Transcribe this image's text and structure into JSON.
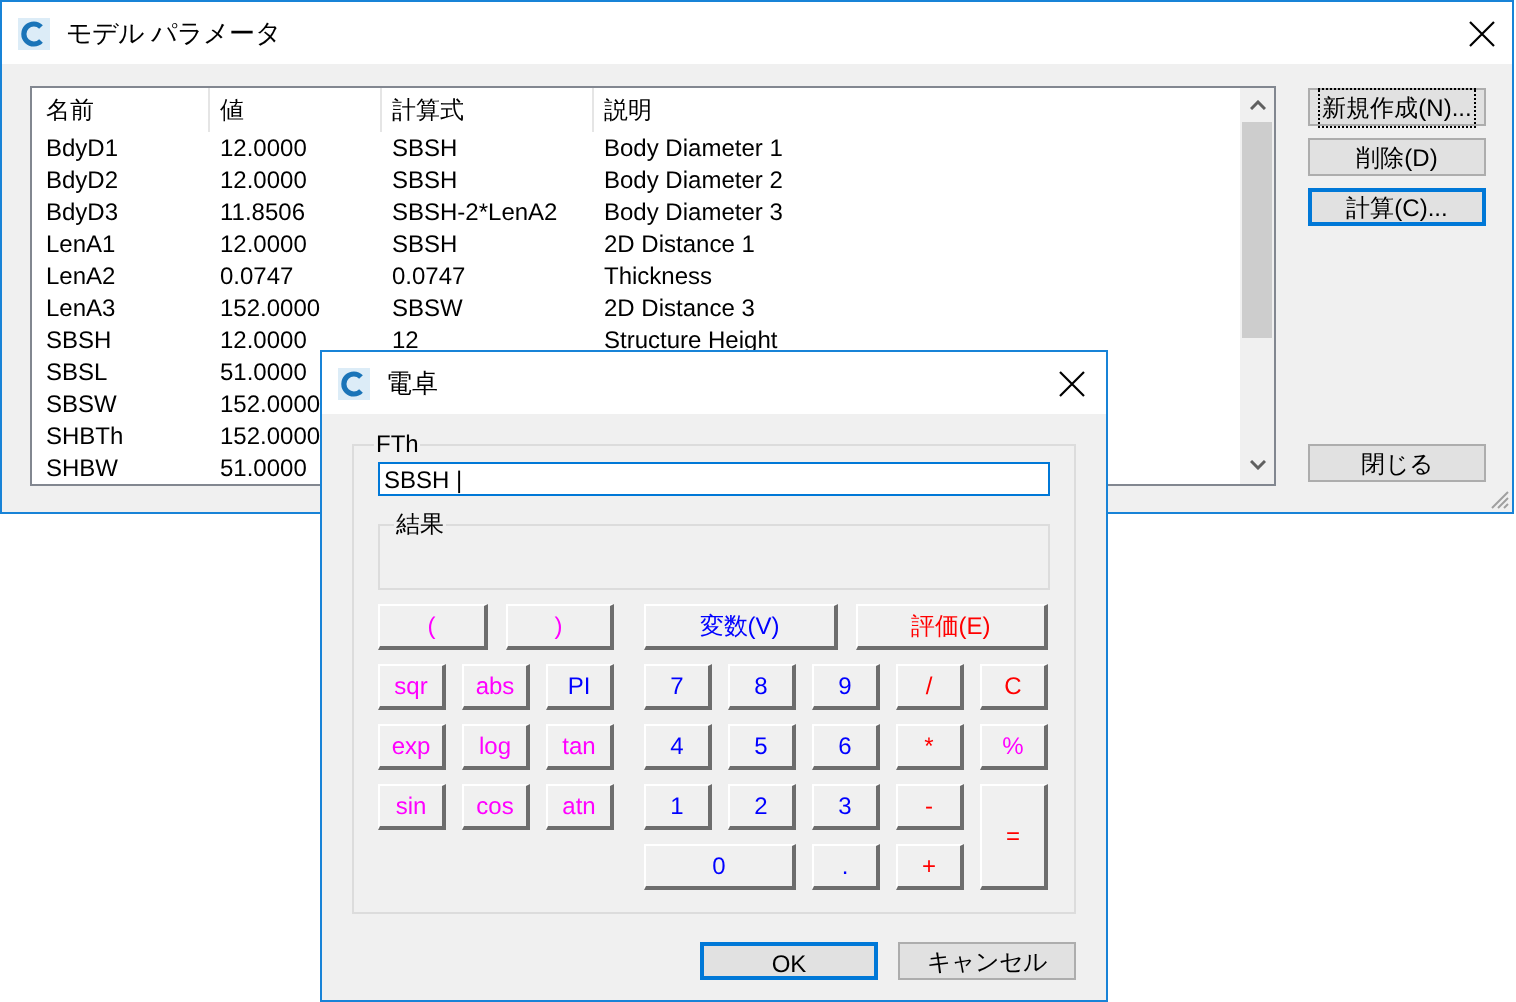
{
  "main_window": {
    "title": "モデル パラメータ",
    "table": {
      "columns": [
        "名前",
        "値",
        "計算式",
        "説明"
      ],
      "rows": [
        {
          "cells": [
            "BdyD1",
            "12.0000",
            "SBSH",
            "Body Diameter 1"
          ]
        },
        {
          "cells": [
            "BdyD2",
            "12.0000",
            "SBSH",
            "Body Diameter 2"
          ]
        },
        {
          "cells": [
            "BdyD3",
            "11.8506",
            "SBSH-2*LenA2",
            "Body Diameter 3"
          ]
        },
        {
          "cells": [
            "LenA1",
            "12.0000",
            "SBSH",
            "2D Distance 1"
          ]
        },
        {
          "cells": [
            "LenA2",
            "0.0747",
            "0.0747",
            "Thickness"
          ]
        },
        {
          "cells": [
            "LenA3",
            "152.0000",
            "SBSW",
            "2D Distance 3"
          ]
        },
        {
          "cells": [
            "SBSH",
            "12.0000",
            "12",
            "Structure Height"
          ]
        },
        {
          "cells": [
            "SBSL",
            "51.0000"
          ]
        },
        {
          "cells": [
            "SBSW",
            "152.0000"
          ]
        },
        {
          "cells": [
            "SHBTh",
            "152.0000"
          ]
        },
        {
          "cells": [
            "SHBW",
            "51.0000"
          ]
        }
      ]
    },
    "buttons": [
      {
        "label": "新規作成(N)...",
        "focused": true,
        "default": false
      },
      {
        "label": "削除(D)",
        "focused": false,
        "default": false
      },
      {
        "label": "計算(C)...",
        "focused": false,
        "default": true
      }
    ],
    "close_button": "閉じる"
  },
  "calculator": {
    "title": "電卓",
    "expression_label": "FTh",
    "expression": "SBSH |",
    "result_label": "結果",
    "top_keys": [
      {
        "label": "(",
        "color": "#ff00ff"
      },
      {
        "label": ")",
        "color": "#ff00ff"
      },
      {
        "label": "変数(V)",
        "color": "#0000ff"
      },
      {
        "label": "評価(E)",
        "color": "#ff0000"
      }
    ],
    "function_keys": [
      {
        "label": "sqr",
        "color": "#ff00ff"
      },
      {
        "label": "abs",
        "color": "#ff00ff"
      },
      {
        "label": "PI",
        "color": "#0000ff"
      },
      {
        "label": "exp",
        "color": "#ff00ff"
      },
      {
        "label": "log",
        "color": "#ff00ff"
      },
      {
        "label": "tan",
        "color": "#ff00ff"
      },
      {
        "label": "sin",
        "color": "#ff00ff"
      },
      {
        "label": "cos",
        "color": "#ff00ff"
      },
      {
        "label": "atn",
        "color": "#ff00ff"
      }
    ],
    "number_keys": [
      {
        "label": "7",
        "color": "#0000ff"
      },
      {
        "label": "8",
        "color": "#0000ff"
      },
      {
        "label": "9",
        "color": "#0000ff"
      },
      {
        "label": "/",
        "color": "#ff0000"
      },
      {
        "label": "C",
        "color": "#ff0000"
      },
      {
        "label": "4",
        "color": "#0000ff"
      },
      {
        "label": "5",
        "color": "#0000ff"
      },
      {
        "label": "6",
        "color": "#0000ff"
      },
      {
        "label": "*",
        "color": "#ff0000"
      },
      {
        "label": "%",
        "color": "#ff00ff"
      },
      {
        "label": "1",
        "color": "#0000ff"
      },
      {
        "label": "2",
        "color": "#0000ff"
      },
      {
        "label": "3",
        "color": "#0000ff"
      },
      {
        "label": "-",
        "color": "#ff0000"
      },
      {
        "label": "=",
        "color": "#ff0000"
      },
      {
        "label": "0",
        "color": "#0000ff"
      },
      {
        "label": ".",
        "color": "#0000ff"
      },
      {
        "label": "+",
        "color": "#ff0000"
      }
    ],
    "buttons": [
      {
        "label": "OK",
        "default": true
      },
      {
        "label": "キャンセル",
        "default": false
      }
    ]
  }
}
